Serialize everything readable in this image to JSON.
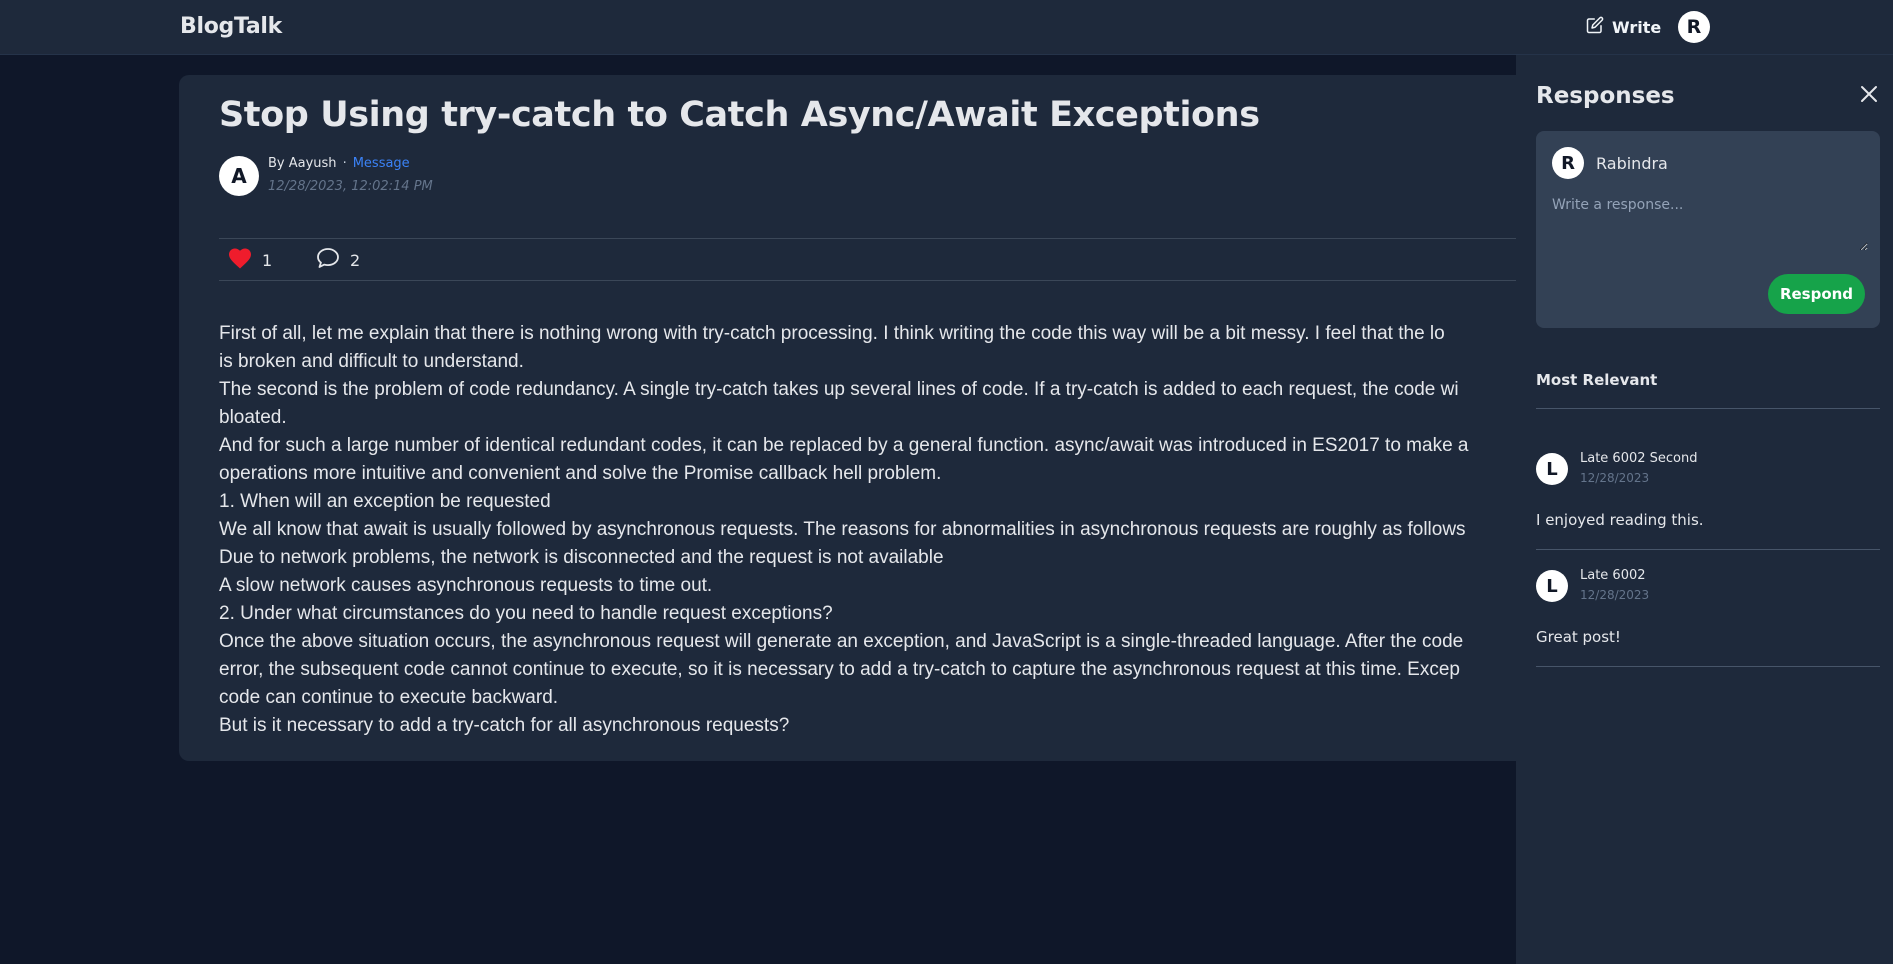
{
  "nav": {
    "brand": "BlogTalk",
    "write_label": "Write",
    "user_initial": "R"
  },
  "article": {
    "title": "Stop Using try-catch to Catch Async/Await Exceptions",
    "author_initial": "A",
    "by_author": "By Aayush",
    "separator": "·",
    "message_label": "Message",
    "date": "12/28/2023, 12:02:14 PM",
    "likes": "1",
    "comments": "2",
    "paragraphs": [
      "First of all, let me explain that there is nothing wrong with try-catch processing. I think writing the code this way will be a bit messy. I feel that the lo",
      "is broken and difficult to understand.",
      "The second is the problem of code redundancy. A single try-catch takes up several lines of code. If a try-catch is added to each request, the code wi",
      "bloated.",
      "And for such a large number of identical redundant codes, it can be replaced by a general function. async/await was introduced in ES2017 to make a",
      "operations more intuitive and convenient and solve the Promise callback hell problem.",
      "1. When will an exception be requested",
      "We all know that await is usually followed by asynchronous requests. The reasons for abnormalities in asynchronous requests are roughly as follows",
      "Due to network problems, the network is disconnected and the request is not available",
      "A slow network causes asynchronous requests to time out.",
      "2. Under what circumstances do you need to handle request exceptions?",
      "Once the above situation occurs, the asynchronous request will generate an exception, and JavaScript is a single-threaded language. After the code",
      "error, the subsequent code cannot continue to execute, so it is necessary to add a try-catch to capture the asynchronous request at this time. Excep",
      "code can continue to execute backward.",
      "But is it necessary to add a try-catch for all asynchronous requests?"
    ]
  },
  "responses": {
    "title": "Responses",
    "compose": {
      "user_initial": "R",
      "user_name": "Rabindra",
      "placeholder": "Write a response...",
      "submit_label": "Respond"
    },
    "sort_label": "Most Relevant",
    "items": [
      {
        "initial": "L",
        "name": "Late 6002 Second",
        "date": "12/28/2023",
        "text": "I enjoyed reading this."
      },
      {
        "initial": "L",
        "name": "Late 6002",
        "date": "12/28/2023",
        "text": "Great post!"
      }
    ]
  },
  "colors": {
    "background": "#0f1729",
    "surface": "#1e293b",
    "accent_link": "#3b82f6",
    "respond_button": "#16a34a",
    "like_heart": "#ef1c2c"
  }
}
